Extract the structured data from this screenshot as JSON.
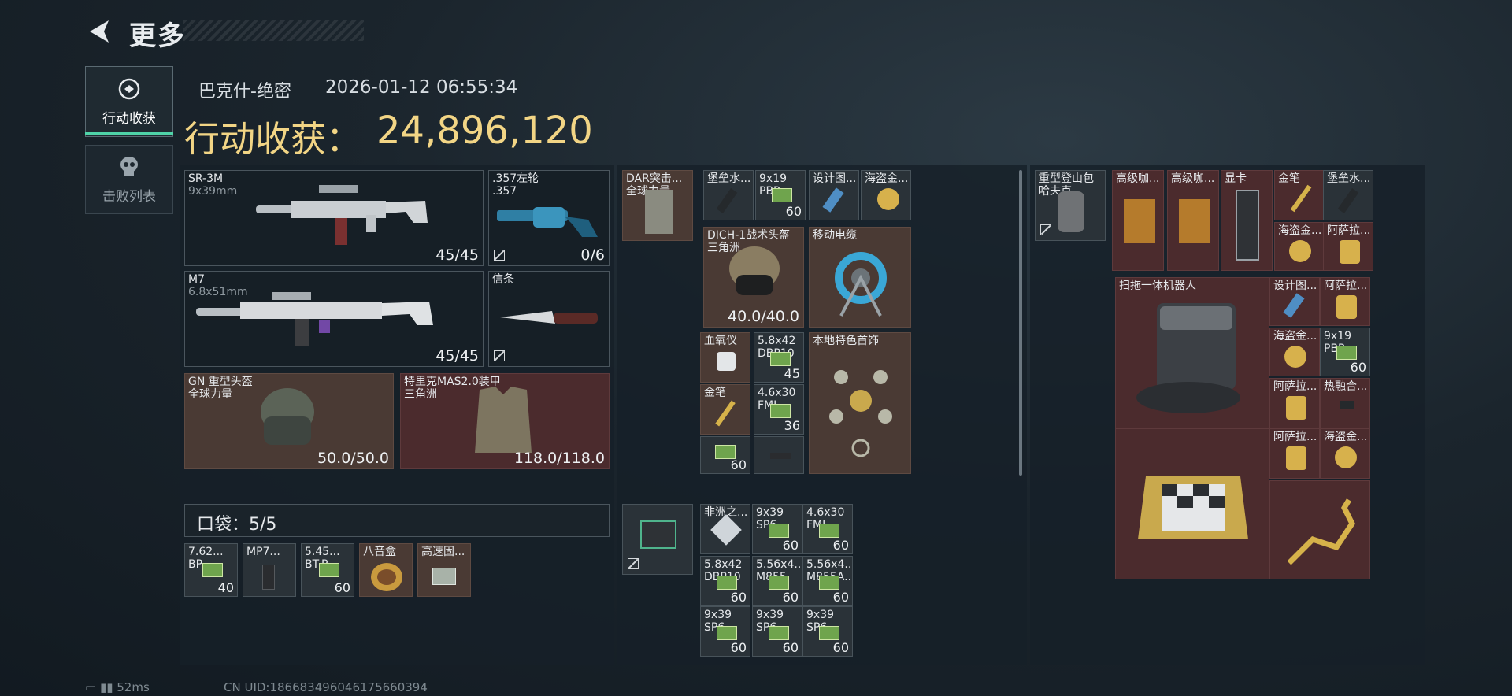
{
  "header": {
    "title": "更多"
  },
  "tabs": [
    {
      "label": "行动收获"
    },
    {
      "label": "击败列表"
    }
  ],
  "info": {
    "map": "巴克什-绝密",
    "time": "2026-01-12 06:55:34"
  },
  "loot": {
    "label": "行动收获：",
    "value": "24,896,120"
  },
  "pocket": {
    "label": "口袋：5/5"
  },
  "gear": {
    "sr3m": {
      "name": "SR-3M",
      "sub": "9x39mm",
      "count": "45/45"
    },
    "revolver": {
      "name": ".357左轮",
      "sub": ".357",
      "count": "0/6"
    },
    "m7": {
      "name": "M7",
      "sub": "6.8x51mm",
      "count": "45/45"
    },
    "knife": {
      "name": "信条"
    },
    "helmet": {
      "name": "GN 重型头盔",
      "sub": "全球力量",
      "count": "50.0/50.0"
    },
    "armor": {
      "name": "特里克MAS2.0装甲",
      "sub": "三角洲",
      "count": "118.0/118.0"
    }
  },
  "pockets": [
    {
      "name": "7.62...",
      "sub": "BP",
      "count": "40"
    },
    {
      "name": "MP7..."
    },
    {
      "name": "5.45...",
      "sub": "BT.P",
      "count": "60"
    },
    {
      "name": "八音盒"
    },
    {
      "name": "高速固..."
    }
  ],
  "bag": {
    "rig": {
      "name": "DAR突击...",
      "sub": "全球力量"
    },
    "items": [
      {
        "name": "堡垒水..."
      },
      {
        "name": "9x19",
        "sub": "PBP",
        "count": "60"
      },
      {
        "name": "设计图..."
      },
      {
        "name": "海盗金..."
      },
      {
        "name": "DICH-1战术头盔",
        "sub": "三角洲",
        "count": "40.0/40.0"
      },
      {
        "name": "移动电缆"
      },
      {
        "name": "血氧仪"
      },
      {
        "name": "5.8x42",
        "sub": "DBP10",
        "count": "45"
      },
      {
        "name": "本地特色首饰"
      },
      {
        "name": "金笔"
      },
      {
        "name": "4.6x30",
        "sub": "FMJ",
        "count": "36"
      },
      {
        "name": "",
        "count": "60"
      }
    ]
  },
  "backpack": {
    "items": [
      {
        "name": "非洲之..."
      },
      {
        "name": "9x39",
        "sub": "SP6",
        "count": "60"
      },
      {
        "name": "4.6x30",
        "sub": "FMJ",
        "count": "60"
      },
      {
        "name": "5.8x42",
        "sub": "DBP10",
        "count": "60"
      },
      {
        "name": "5.56x4...",
        "sub": "M855",
        "count": "60"
      },
      {
        "name": "5.56x4...",
        "sub": "M855A...",
        "count": "60"
      },
      {
        "name": "9x39",
        "sub": "SP6",
        "count": "60"
      },
      {
        "name": "9x39",
        "sub": "SP6",
        "count": "60"
      },
      {
        "name": "9x39",
        "sub": "SP6",
        "count": "60"
      }
    ]
  },
  "case": {
    "bag": {
      "name": "重型登山包",
      "sub": "哈夫克"
    },
    "items": [
      {
        "name": "高级咖..."
      },
      {
        "name": "高级咖..."
      },
      {
        "name": "显卡"
      },
      {
        "name": "金笔"
      },
      {
        "name": "堡垒水..."
      },
      {
        "name": "海盗金..."
      },
      {
        "name": "阿萨拉..."
      },
      {
        "name": "扫拖一体机器人"
      },
      {
        "name": "设计图..."
      },
      {
        "name": "阿萨拉..."
      },
      {
        "name": "海盗金..."
      },
      {
        "name": "9x19",
        "sub": "PBP",
        "count": "60"
      },
      {
        "name": "阿萨拉..."
      },
      {
        "name": "热融合..."
      },
      {
        "name": "阿萨拉..."
      },
      {
        "name": "海盗金..."
      }
    ]
  },
  "footer": {
    "ping": "52ms",
    "uid": "CN UID:186683496046175660394"
  }
}
